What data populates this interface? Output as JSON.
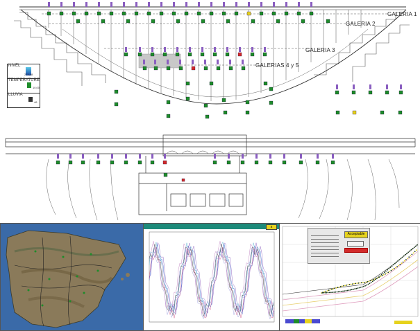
{
  "galleries": [
    {
      "label": "GALERIA 1"
    },
    {
      "label": "GALERIA 2"
    },
    {
      "label": "GALERIA 3"
    },
    {
      "label": "GALERIAS 4 y 5"
    }
  ],
  "legends": {
    "nivel": {
      "title": "NIVEL",
      "value": "274,48"
    },
    "temperature": {
      "title": "TEMPERATURE",
      "value": "10,00"
    },
    "lluvia": {
      "title": "LLUVIA",
      "value": "46"
    }
  },
  "colors": {
    "sensor_green": "#1e8c2a",
    "sensor_red": "#d22a2a",
    "sensor_yellow": "#e6d21e",
    "instrument_purple": "#8a5ec0",
    "map_sea": "#3a6aa8",
    "chart_bg": "#ffffff",
    "app_title_bar": "#1d8a7a"
  },
  "icons": [
    "green-sensor-icon",
    "pendulum-icon",
    "rain-gauge-icon",
    "thermometer-icon"
  ],
  "panels": {
    "map": {
      "name": "iberian-peninsula-map"
    },
    "timeseries": {
      "title_button": "x"
    },
    "analysis": {
      "button_top": "Acceptable",
      "button_mid": "",
      "button_bottom": ""
    }
  }
}
